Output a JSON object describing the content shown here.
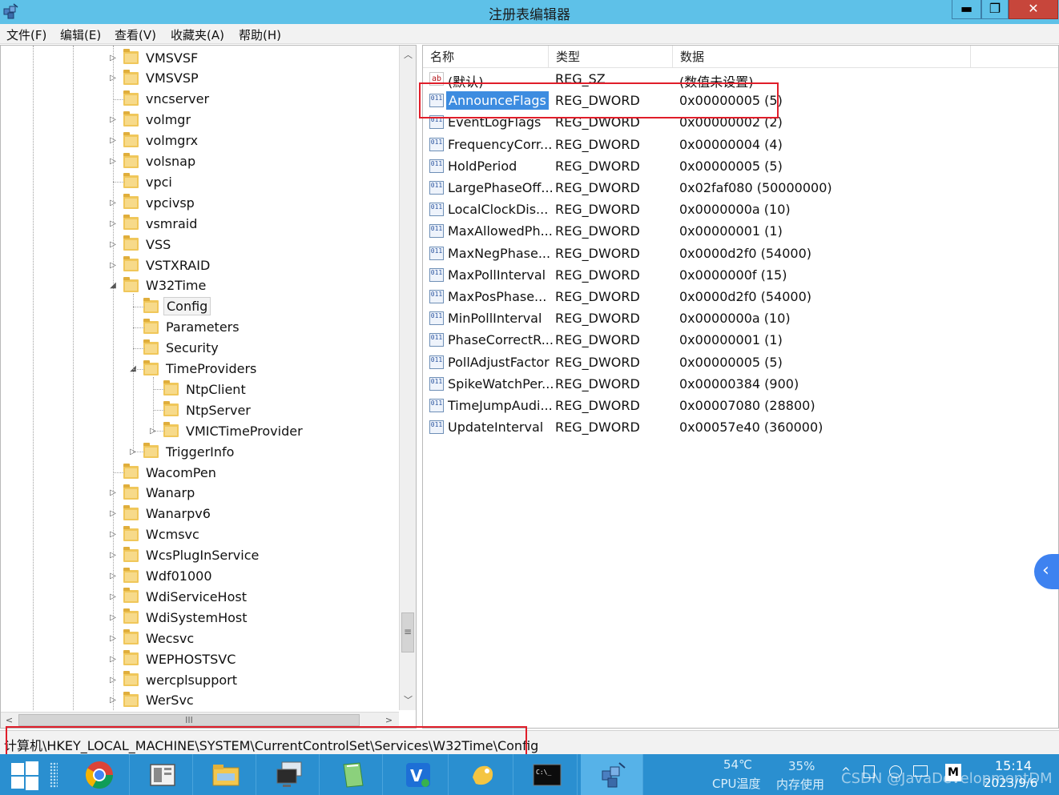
{
  "window": {
    "title": "注册表编辑器",
    "min_glyph": "▬",
    "max_glyph": "❐",
    "close_glyph": "✕"
  },
  "menu": [
    "文件(F)",
    "编辑(E)",
    "查看(V)",
    "收藏夹(A)",
    "帮助(H)"
  ],
  "tree": {
    "items": [
      {
        "label": "VMSVSF",
        "expander": "▷"
      },
      {
        "label": "VMSVSP",
        "expander": "▷"
      },
      {
        "label": "vncserver",
        "expander": ""
      },
      {
        "label": "volmgr",
        "expander": "▷"
      },
      {
        "label": "volmgrx",
        "expander": "▷"
      },
      {
        "label": "volsnap",
        "expander": "▷"
      },
      {
        "label": "vpci",
        "expander": ""
      },
      {
        "label": "vpcivsp",
        "expander": "▷"
      },
      {
        "label": "vsmraid",
        "expander": "▷"
      },
      {
        "label": "VSS",
        "expander": "▷"
      },
      {
        "label": "VSTXRAID",
        "expander": "▷"
      },
      {
        "label": "W32Time",
        "expander": "◢"
      },
      {
        "label": "Config",
        "expander": "",
        "selected": true
      },
      {
        "label": "Parameters",
        "expander": ""
      },
      {
        "label": "Security",
        "expander": ""
      },
      {
        "label": "TimeProviders",
        "expander": "◢"
      },
      {
        "label": "NtpClient",
        "expander": ""
      },
      {
        "label": "NtpServer",
        "expander": ""
      },
      {
        "label": "VMICTimeProvider",
        "expander": "▷"
      },
      {
        "label": "TriggerInfo",
        "expander": "▷"
      },
      {
        "label": "WacomPen",
        "expander": ""
      },
      {
        "label": "Wanarp",
        "expander": "▷"
      },
      {
        "label": "Wanarpv6",
        "expander": "▷"
      },
      {
        "label": "Wcmsvc",
        "expander": "▷"
      },
      {
        "label": "WcsPlugInService",
        "expander": "▷"
      },
      {
        "label": "Wdf01000",
        "expander": "▷"
      },
      {
        "label": "WdiServiceHost",
        "expander": "▷"
      },
      {
        "label": "WdiSystemHost",
        "expander": "▷"
      },
      {
        "label": "Wecsvc",
        "expander": "▷"
      },
      {
        "label": "WEPHOSTSVC",
        "expander": "▷"
      },
      {
        "label": "wercplsupport",
        "expander": "▷"
      },
      {
        "label": "WerSvc",
        "expander": "▷"
      }
    ],
    "scroll_up": "︿",
    "scroll_down": "﹀",
    "scroll_left": "<",
    "scroll_right": ">",
    "vgrip": "≡",
    "hgrip": "III"
  },
  "list": {
    "columns": [
      "名称",
      "类型",
      "数据"
    ],
    "rows": [
      {
        "icon": "ab",
        "name": "(默认)",
        "type": "REG_SZ",
        "data": "(数值未设置)"
      },
      {
        "icon": "011",
        "name": "AnnounceFlags",
        "type": "REG_DWORD",
        "data": "0x00000005 (5)",
        "selected": true
      },
      {
        "icon": "011",
        "name": "EventLogFlags",
        "type": "REG_DWORD",
        "data": "0x00000002 (2)"
      },
      {
        "icon": "011",
        "name": "FrequencyCorr...",
        "type": "REG_DWORD",
        "data": "0x00000004 (4)"
      },
      {
        "icon": "011",
        "name": "HoldPeriod",
        "type": "REG_DWORD",
        "data": "0x00000005 (5)"
      },
      {
        "icon": "011",
        "name": "LargePhaseOff...",
        "type": "REG_DWORD",
        "data": "0x02faf080 (50000000)"
      },
      {
        "icon": "011",
        "name": "LocalClockDis...",
        "type": "REG_DWORD",
        "data": "0x0000000a (10)"
      },
      {
        "icon": "011",
        "name": "MaxAllowedPh...",
        "type": "REG_DWORD",
        "data": "0x00000001 (1)"
      },
      {
        "icon": "011",
        "name": "MaxNegPhase...",
        "type": "REG_DWORD",
        "data": "0x0000d2f0 (54000)"
      },
      {
        "icon": "011",
        "name": "MaxPollInterval",
        "type": "REG_DWORD",
        "data": "0x0000000f (15)"
      },
      {
        "icon": "011",
        "name": "MaxPosPhase...",
        "type": "REG_DWORD",
        "data": "0x0000d2f0 (54000)"
      },
      {
        "icon": "011",
        "name": "MinPollInterval",
        "type": "REG_DWORD",
        "data": "0x0000000a (10)"
      },
      {
        "icon": "011",
        "name": "PhaseCorrectR...",
        "type": "REG_DWORD",
        "data": "0x00000001 (1)"
      },
      {
        "icon": "011",
        "name": "PollAdjustFactor",
        "type": "REG_DWORD",
        "data": "0x00000005 (5)"
      },
      {
        "icon": "011",
        "name": "SpikeWatchPer...",
        "type": "REG_DWORD",
        "data": "0x00000384 (900)"
      },
      {
        "icon": "011",
        "name": "TimeJumpAudi...",
        "type": "REG_DWORD",
        "data": "0x00007080 (28800)"
      },
      {
        "icon": "011",
        "name": "UpdateInterval",
        "type": "REG_DWORD",
        "data": "0x00057e40 (360000)"
      }
    ]
  },
  "side_tab_glyph": "‹",
  "status": {
    "path": "计算机\\HKEY_LOCAL_MACHINE\\SYSTEM\\CurrentControlSet\\Services\\W32Time\\Config"
  },
  "taskbar": {
    "apps": [
      "chrome-icon",
      "server-manager-icon",
      "file-explorer-icon",
      "remote-desktop-icon",
      "notepad-icon",
      "visual-studio-icon",
      "app-icon",
      "cmd-icon",
      "regedit-icon"
    ],
    "cmd_text": "C:\\_",
    "cpu_temp": "54℃",
    "cpu_label": "CPU温度",
    "mem_percent": "35%",
    "mem_label": "内存使用",
    "tray_chevron": "^",
    "m_label": "M",
    "time": "15:14",
    "date": "2023/9/6",
    "watermark": "CSDN @JavaDevelopmentDM"
  },
  "colors": {
    "titlebar": "#5ec1e8",
    "close_button": "#c7463b",
    "selection": "#3d8ce0",
    "annotation": "#e01e2a",
    "taskbar": "#2a8fd0"
  }
}
